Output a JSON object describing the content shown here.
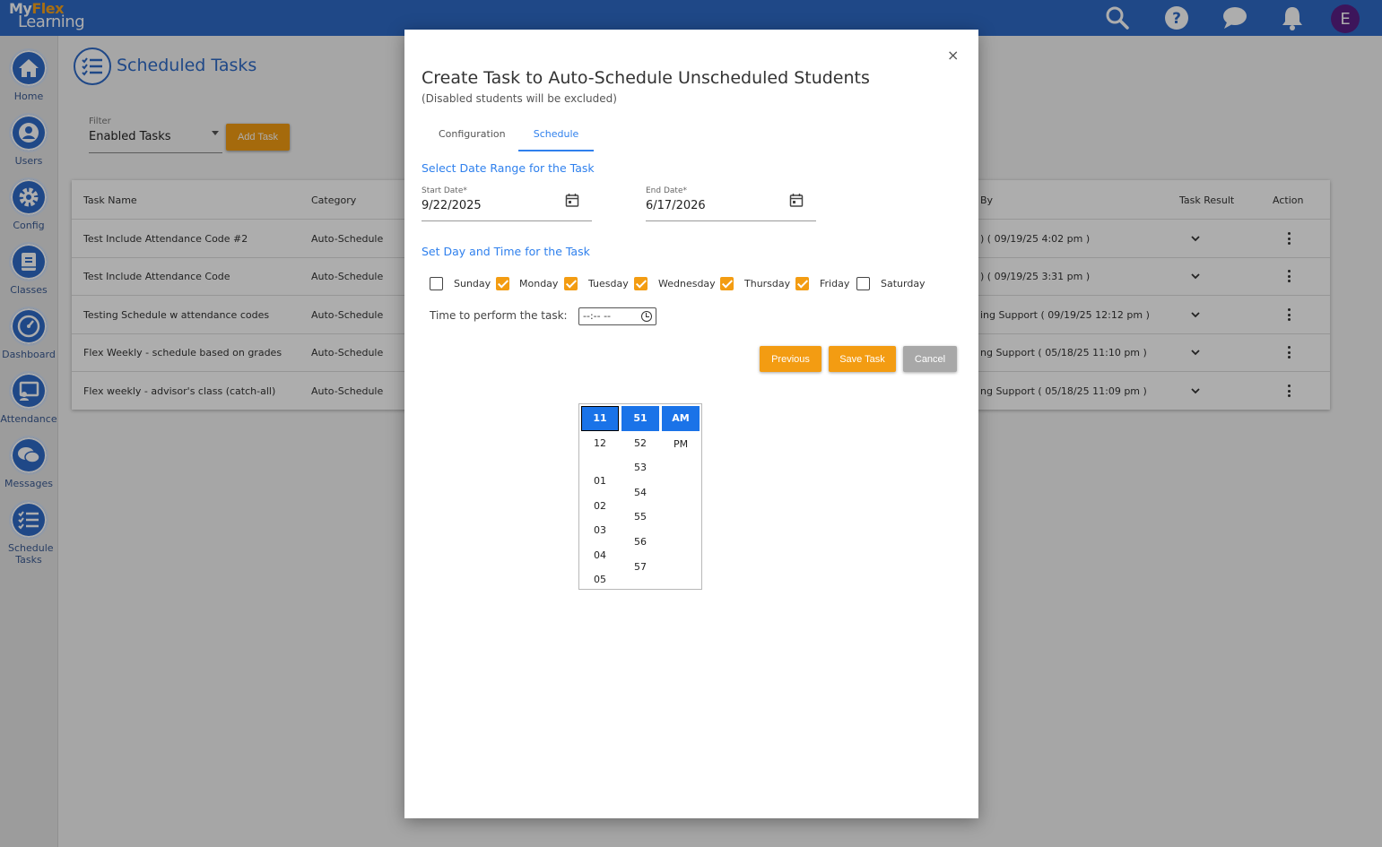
{
  "app": {
    "logo_line1_prefix": "My",
    "logo_line1_accent": "Flex",
    "logo_line2": "Learning",
    "avatar_initial": "E"
  },
  "header_icons": [
    "search-icon",
    "help-icon",
    "chat-icon",
    "bell-icon"
  ],
  "sidebar": {
    "items": [
      {
        "label": "Home",
        "icon": "home-icon"
      },
      {
        "label": "Users",
        "icon": "user-icon"
      },
      {
        "label": "Config",
        "icon": "gear-icon"
      },
      {
        "label": "Classes",
        "icon": "book-icon"
      },
      {
        "label": "Dashboard",
        "icon": "gauge-icon"
      },
      {
        "label": "Attendance",
        "icon": "attendance-icon"
      },
      {
        "label": "Messages",
        "icon": "messages-icon"
      },
      {
        "label": "Schedule Tasks",
        "icon": "checklist-icon"
      }
    ]
  },
  "page": {
    "title": "Scheduled Tasks",
    "filter_label": "Filter",
    "filter_value": "Enabled Tasks",
    "add_task_label": "Add Task"
  },
  "table": {
    "headers": {
      "task_name": "Task Name",
      "category": "Category",
      "by": "By",
      "task_result": "Task Result",
      "action": "Action"
    },
    "rows": [
      {
        "name": "Test Include Attendance Code #2",
        "category": "Auto-Schedule",
        "by": ") ( 09/19/25 4:02 pm )"
      },
      {
        "name": "Test Include Attendance Code",
        "category": "Auto-Schedule",
        "by": ") ( 09/19/25 3:31 pm )"
      },
      {
        "name": "Testing Schedule w attendance codes",
        "category": "Auto-Schedule",
        "by": "ing Support ( 09/19/25 12:12 pm )"
      },
      {
        "name": "Flex Weekly - schedule based on grades",
        "category": "Auto-Schedule",
        "by": "ng Support ( 05/18/25 11:10 pm )"
      },
      {
        "name": "Flex weekly - advisor's class (catch-all)",
        "category": "Auto-Schedule",
        "by": "ng Support ( 05/18/25 11:09 pm )"
      }
    ]
  },
  "modal": {
    "close_label": "×",
    "title": "Create Task to Auto-Schedule Unscheduled Students",
    "subtitle": "(Disabled students will be excluded)",
    "tabs": [
      "Configuration",
      "Schedule"
    ],
    "active_tab": "Schedule",
    "date_section_title": "Select Date Range for the Task",
    "start_date_label": "Start Date*",
    "start_date_value": "9/22/2025",
    "end_date_label": "End Date*",
    "end_date_value": "6/17/2026",
    "day_time_section_title": "Set Day and Time for the Task",
    "days": [
      {
        "label": "Sunday",
        "checked": false
      },
      {
        "label": "Monday",
        "checked": true
      },
      {
        "label": "Tuesday",
        "checked": true
      },
      {
        "label": "Wednesday",
        "checked": true
      },
      {
        "label": "Thursday",
        "checked": true
      },
      {
        "label": "Friday",
        "checked": true
      },
      {
        "label": "Saturday",
        "checked": false
      }
    ],
    "time_label": "Time to perform the task:",
    "time_value": "--:-- --",
    "buttons": {
      "previous": "Previous",
      "save": "Save Task",
      "cancel": "Cancel"
    }
  },
  "time_picker": {
    "hours": [
      "11",
      "12",
      "01",
      "02",
      "03",
      "04",
      "05"
    ],
    "minutes": [
      "51",
      "52",
      "53",
      "54",
      "55",
      "56",
      "57"
    ],
    "periods": [
      "AM",
      "PM"
    ],
    "selected_hour": "11",
    "selected_minute": "51",
    "selected_period": "AM"
  },
  "colors": {
    "brand_blue": "#2f6ac8",
    "accent_orange": "#f39c12",
    "link_blue": "#2f80ed",
    "picker_selected": "#1a73e8",
    "avatar_purple": "#5b1f86"
  }
}
